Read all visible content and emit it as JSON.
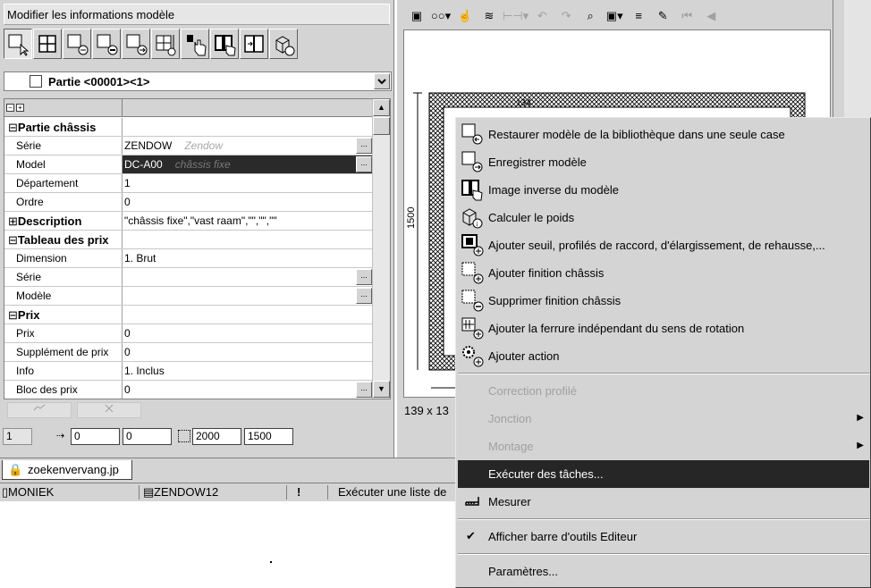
{
  "panel": {
    "title": "Modifier les informations modèle",
    "part_selector": "Partie <00001><1>",
    "grid": {
      "sections": [
        {
          "title": "Partie châssis",
          "expander": "⊟",
          "rows": [
            {
              "label": "Série",
              "value": "ZENDOW",
              "hint": "Zendow",
              "has_button": true
            },
            {
              "label": "Model",
              "value": "DC-A00",
              "hint": "châssis fixe",
              "has_button": true,
              "selected": true
            },
            {
              "label": "Département",
              "value": "1"
            },
            {
              "label": "Ordre",
              "value": "0"
            }
          ]
        },
        {
          "title": "Description",
          "expander": "⊞",
          "value": "\"châssis fixe\",\"vast raam\",\"\",\"\",\"\""
        },
        {
          "title": "Tableau des prix",
          "expander": "⊟",
          "rows": [
            {
              "label": "Dimension",
              "value": "1. Brut"
            },
            {
              "label": "Série",
              "value": "",
              "has_button": true
            },
            {
              "label": "Modèle",
              "value": "",
              "has_button": true
            }
          ]
        },
        {
          "title": "Prix",
          "expander": "⊟",
          "rows": [
            {
              "label": "Prix",
              "value": "0"
            },
            {
              "label": "Supplément de prix",
              "value": "0"
            },
            {
              "label": "Info",
              "value": "1. Inclus"
            },
            {
              "label": "Bloc des prix",
              "value": "0",
              "has_button": true
            }
          ]
        }
      ]
    },
    "inputs": {
      "field1": "1",
      "field2": "0",
      "field3": "0",
      "width": "2000",
      "height": "1500"
    }
  },
  "canvas": {
    "size_label": "139 x 13",
    "dimension_top": "134",
    "dimension_left": "1500"
  },
  "tab": {
    "label": "zoekenvervang.jp"
  },
  "status": {
    "user": "MONIEK",
    "database": "ZENDOW12",
    "message": "Exécuter une liste de"
  },
  "context_menu": {
    "items": [
      {
        "label": "Restaurer modèle de la bibliothèque dans une seule case",
        "icon": "restore-model-icon"
      },
      {
        "label": "Enregistrer modèle",
        "icon": "save-model-icon"
      },
      {
        "label": "Image inverse du modèle",
        "icon": "mirror-model-icon"
      },
      {
        "label": "Calculer le poids",
        "icon": "weight-icon"
      },
      {
        "label": "Ajouter seuil, profilés de raccord, d'élargissement, de rehausse,...",
        "icon": "add-profile-icon"
      },
      {
        "label": "Ajouter finition châssis",
        "icon": "add-finish-icon"
      },
      {
        "label": "Supprimer finition châssis",
        "icon": "remove-finish-icon"
      },
      {
        "label": "Ajouter la ferrure indépendant du sens de rotation",
        "icon": "add-hardware-icon"
      },
      {
        "label": "Ajouter action",
        "icon": "add-action-icon"
      },
      {
        "label": "Correction profilé",
        "disabled": true
      },
      {
        "label": "Jonction",
        "disabled": true,
        "submenu": true
      },
      {
        "label": "Montage",
        "disabled": true,
        "submenu": true
      },
      {
        "label": "Exécuter des tâches...",
        "highlighted": true
      },
      {
        "label": "Mesurer",
        "icon": "measure-icon"
      },
      {
        "label": "Afficher barre d'outils Editeur",
        "checked": true
      },
      {
        "label": "Paramètres..."
      }
    ]
  }
}
